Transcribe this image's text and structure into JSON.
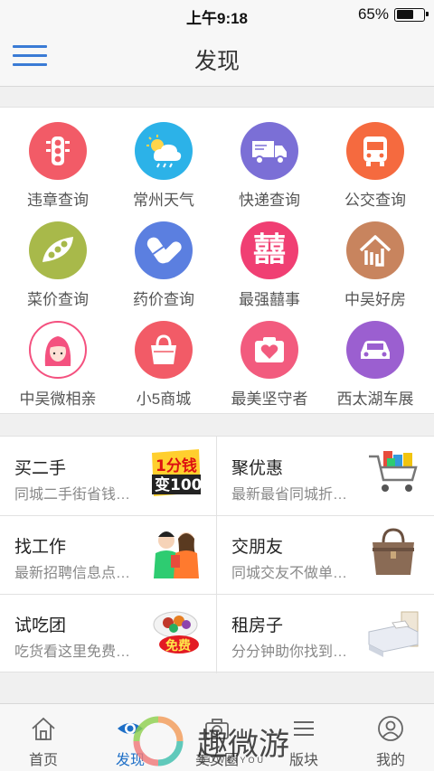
{
  "status_bar": {
    "time": "上午9:18",
    "battery": "65%",
    "battery_level": 0.65
  },
  "nav": {
    "title": "发现"
  },
  "grid": [
    {
      "label": "违章查询",
      "icon": "traffic-light-icon",
      "color": "#f25b67"
    },
    {
      "label": "常州天气",
      "icon": "weather-icon",
      "color": "#2cb2e8"
    },
    {
      "label": "快递查询",
      "icon": "delivery-truck-icon",
      "color": "#7b6fd6"
    },
    {
      "label": "公交查询",
      "icon": "bus-icon",
      "color": "#f56a3f"
    },
    {
      "label": "菜价查询",
      "icon": "pea-pod-icon",
      "color": "#a8b94a"
    },
    {
      "label": "药价查询",
      "icon": "pill-icon",
      "color": "#5b7fe0"
    },
    {
      "label": "最强囍事",
      "icon": "double-happiness-icon",
      "color": "#f03f73"
    },
    {
      "label": "中吴好房",
      "icon": "house-icon",
      "color": "#c8845e"
    },
    {
      "label": "中吴微相亲",
      "icon": "girl-avatar-icon",
      "color": "#f4517f"
    },
    {
      "label": "小5商城",
      "icon": "shopping-bag-icon",
      "color": "#f25b67"
    },
    {
      "label": "最美坚守者",
      "icon": "heart-camera-icon",
      "color": "#f25b7e"
    },
    {
      "label": "西太湖车展",
      "icon": "car-icon",
      "color": "#9b5fd0"
    }
  ],
  "list": [
    {
      "title": "买二手",
      "subtitle": "同城二手街省钱…",
      "image": "one-cent-promo-image"
    },
    {
      "title": "聚优惠",
      "subtitle": "最新最省同城折…",
      "image": "shopping-cart-image"
    },
    {
      "title": "找工作",
      "subtitle": "最新招聘信息点…",
      "image": "chefs-image"
    },
    {
      "title": "交朋友",
      "subtitle": "同城交友不做单…",
      "image": "handbag-image"
    },
    {
      "title": "试吃团",
      "subtitle": "吃货看这里免费…",
      "image": "free-food-image"
    },
    {
      "title": "租房子",
      "subtitle": "分分钟助你找到…",
      "image": "bed-image"
    }
  ],
  "promo": {
    "one_cent_top": "1分钱",
    "one_cent_bottom": "变100",
    "free": "免费"
  },
  "tabs": [
    {
      "label": "首页",
      "icon": "home-icon",
      "active": false
    },
    {
      "label": "发现",
      "icon": "eye-icon",
      "active": true
    },
    {
      "label": "美女圈",
      "icon": "camera-icon",
      "active": false
    },
    {
      "label": "版块",
      "icon": "list-icon",
      "active": false
    },
    {
      "label": "我的",
      "icon": "profile-icon",
      "active": false
    }
  ],
  "watermark": {
    "text": "趣微游",
    "subtext": "QUWEIYOU"
  }
}
